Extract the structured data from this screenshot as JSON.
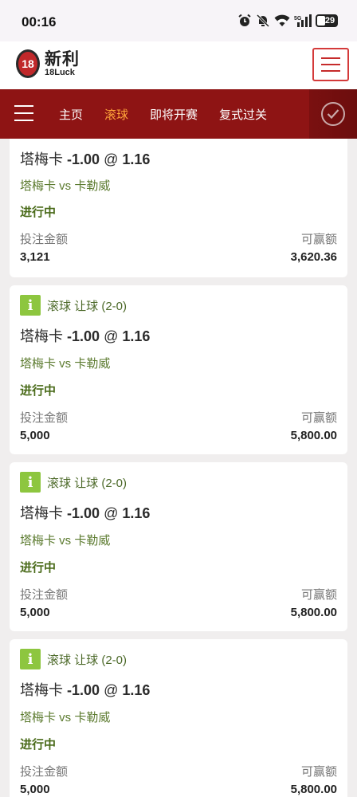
{
  "status_bar": {
    "time": "00:16",
    "battery": "29"
  },
  "header": {
    "logo_cn": "新利",
    "logo_en": "18Luck",
    "logo_badge": "18"
  },
  "nav": {
    "items": [
      {
        "label": "主页",
        "active": false
      },
      {
        "label": "滚球",
        "active": true
      },
      {
        "label": "即将开赛",
        "active": false
      },
      {
        "label": "复式过关",
        "active": false
      }
    ]
  },
  "bets": [
    {
      "type": "",
      "team": "塔梅卡",
      "handicap": "-1.00",
      "at": "@",
      "odds": "1.16",
      "match": "塔梅卡 vs 卡勒威",
      "status": "进行中",
      "stake_label": "投注金额",
      "stake": "3,121",
      "win_label": "可赢额",
      "win": "3,620.36"
    },
    {
      "type": "滚球 让球 (2-0)",
      "team": "塔梅卡",
      "handicap": "-1.00",
      "at": "@",
      "odds": "1.16",
      "match": "塔梅卡 vs 卡勒威",
      "status": "进行中",
      "stake_label": "投注金额",
      "stake": "5,000",
      "win_label": "可赢额",
      "win": "5,800.00"
    },
    {
      "type": "滚球 让球 (2-0)",
      "team": "塔梅卡",
      "handicap": "-1.00",
      "at": "@",
      "odds": "1.16",
      "match": "塔梅卡 vs 卡勒威",
      "status": "进行中",
      "stake_label": "投注金额",
      "stake": "5,000",
      "win_label": "可赢额",
      "win": "5,800.00"
    },
    {
      "type": "滚球 让球 (2-0)",
      "team": "塔梅卡",
      "handicap": "-1.00",
      "at": "@",
      "odds": "1.16",
      "match": "塔梅卡 vs 卡勒威",
      "status": "进行中",
      "stake_label": "投注金额",
      "stake": "5,000",
      "win_label": "可赢额",
      "win": "5,800.00"
    }
  ],
  "info_icon_glyph": "i"
}
